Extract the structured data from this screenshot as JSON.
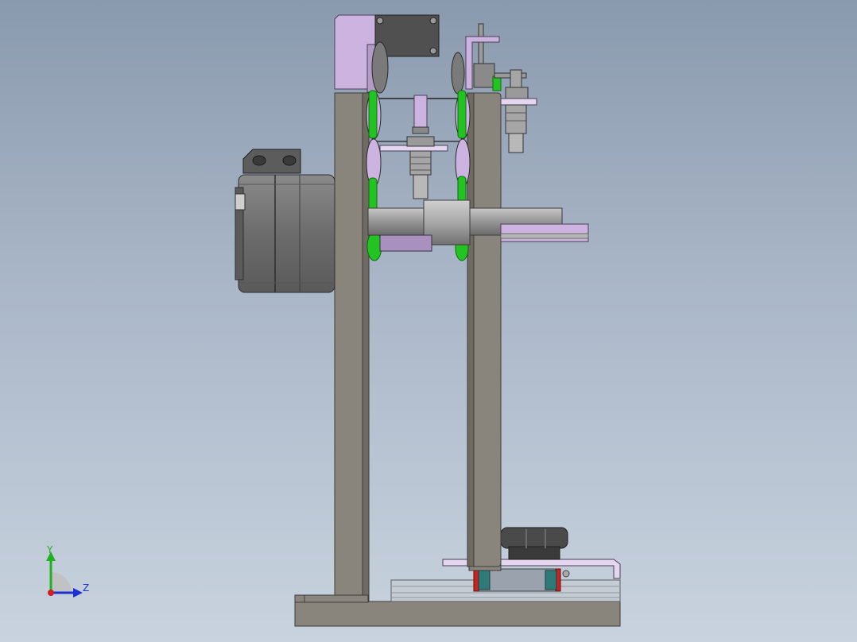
{
  "viewport": {
    "background_top": "#8a9aae",
    "background_bottom": "#c9d3df"
  },
  "model": {
    "colors": {
      "frame": "#8a857c",
      "frame_edge": "#3d3b37",
      "bracket": "#cdb4e0",
      "motor": "#707070",
      "motor_dark": "#4e4e4e",
      "belt": "#22c322",
      "shaft": "#9a9a9a",
      "rail": "#2f7a78",
      "rail_stop": "#cc2222",
      "knob": "#4a4a4a"
    }
  },
  "triad": {
    "y_label": "Y",
    "z_label": "Z",
    "y_color": "#1fb11f",
    "z_color": "#1f2fd0",
    "x_color": "#d01f1f"
  }
}
